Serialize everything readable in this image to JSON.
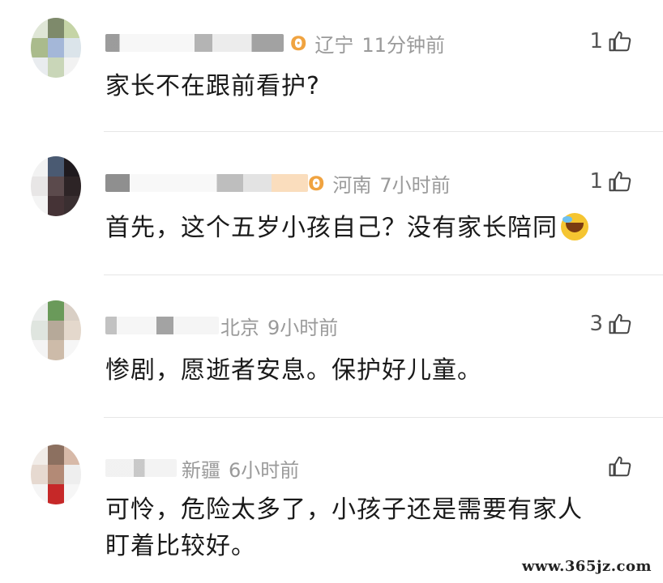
{
  "comments": [
    {
      "location": "辽宁",
      "time": "11分钟前",
      "likes": "1",
      "badge": "ʘ",
      "text": "家长不在跟前看护?"
    },
    {
      "location": "河南",
      "time": "7小时前",
      "likes": "1",
      "badge": "ʘ",
      "text": "首先，这个五岁小孩自己？没有家长陪同"
    },
    {
      "location": "北京",
      "time": "9小时前",
      "likes": "3",
      "text": "惨剧，愿逝者安息。保护好儿童。"
    },
    {
      "location": "新疆",
      "time": "6小时前",
      "likes": "",
      "text_line1": "可怜，危险太多了，小孩子还是需要有家人",
      "text_line2": "盯着比较好。"
    }
  ],
  "icons": {
    "like": "thumbs-up-icon",
    "vip_badge": "vip-badge-icon",
    "emoji": "crying-face-emoji"
  },
  "watermark": "www.365jz.com"
}
